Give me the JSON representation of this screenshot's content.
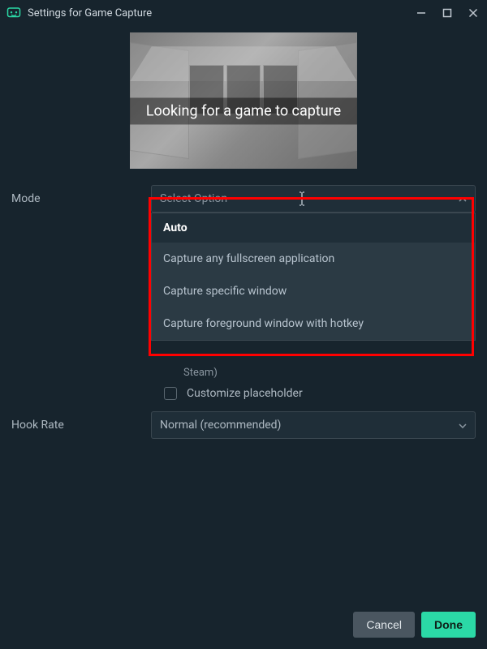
{
  "window": {
    "title": "Settings for Game Capture"
  },
  "preview": {
    "banner_text": "Looking for a game to capture"
  },
  "form": {
    "mode": {
      "label": "Mode",
      "placeholder": "Select Option",
      "options": [
        "Auto",
        "Capture any fullscreen application",
        "Capture specific window",
        "Capture foreground window with hotkey"
      ]
    },
    "obscured_hint": "Steam)",
    "customize_placeholder": {
      "label": "Customize placeholder",
      "checked": false
    },
    "hook_rate": {
      "label": "Hook Rate",
      "value": "Normal (recommended)"
    }
  },
  "buttons": {
    "cancel": "Cancel",
    "done": "Done"
  }
}
